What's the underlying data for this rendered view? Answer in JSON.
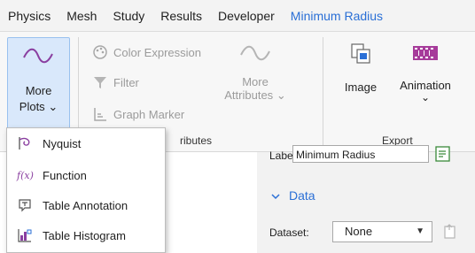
{
  "menubar": {
    "tabs": [
      "Physics",
      "Mesh",
      "Study",
      "Results",
      "Developer",
      "Minimum Radius"
    ],
    "active_tab": "Minimum Radius"
  },
  "ribbon": {
    "more_plots": {
      "line1": "More",
      "line2": "Plots",
      "caret": "⌄"
    },
    "color_expression": "Color Expression",
    "filter": "Filter",
    "graph_marker": "Graph Marker",
    "more_attributes": {
      "line1": "More",
      "line2": "Attributes",
      "caret": "⌄"
    },
    "attributes_group": "ributes",
    "image": "Image",
    "animation": {
      "label": "Animation",
      "caret": "⌄"
    },
    "export_group": "Export"
  },
  "dropdown": {
    "items": [
      {
        "label": "Nyquist",
        "icon": "nyquist-icon"
      },
      {
        "label": "Function",
        "icon": "function-icon"
      },
      {
        "label": "Table Annotation",
        "icon": "table-annotation-icon"
      },
      {
        "label": "Table Histogram",
        "icon": "table-histogram-icon"
      }
    ]
  },
  "settings": {
    "label_text": "Label:",
    "label_value": "Minimum Radius",
    "section": "Data",
    "dataset_label": "Dataset:",
    "dataset_value": "None"
  },
  "colors": {
    "accent": "#2a6fd6",
    "selected_bg": "#d9e8fb",
    "selected_border": "#99c1ef",
    "wave": "#8a3fa0",
    "animation_icon": "#a63b9a"
  }
}
